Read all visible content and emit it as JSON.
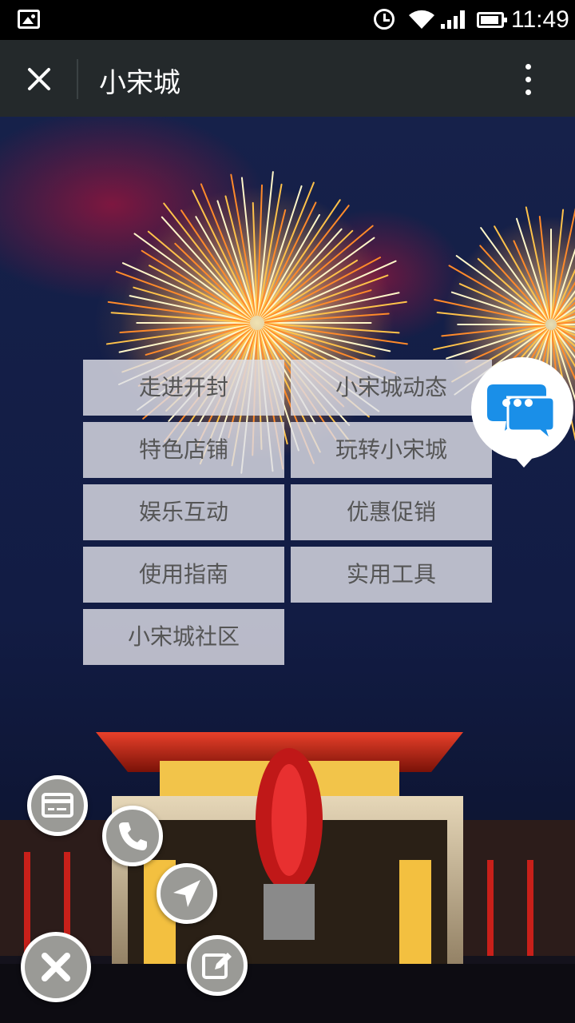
{
  "status_bar": {
    "time": "11:49",
    "icons": [
      "gallery-icon",
      "alarm-icon",
      "wifi-icon",
      "signal-icon",
      "battery-icon"
    ]
  },
  "title_bar": {
    "title": "小宋城",
    "close_icon": "close-icon",
    "more_icon": "more-vertical-icon"
  },
  "menu": {
    "items": [
      {
        "label": "走进开封"
      },
      {
        "label": "小宋城动态"
      },
      {
        "label": "特色店铺"
      },
      {
        "label": "玩转小宋城"
      },
      {
        "label": "娱乐互动"
      },
      {
        "label": "优惠促销"
      },
      {
        "label": "使用指南"
      },
      {
        "label": "实用工具"
      },
      {
        "label": "小宋城社区"
      }
    ]
  },
  "chat": {
    "icon": "chat-bubble-icon",
    "color": "#1a8fe8"
  },
  "floating_buttons": [
    {
      "icon": "card-icon"
    },
    {
      "icon": "phone-icon"
    },
    {
      "icon": "navigation-arrow-icon"
    },
    {
      "icon": "close-icon"
    },
    {
      "icon": "edit-icon"
    }
  ],
  "colors": {
    "title_bar": "#24292b",
    "status_bar": "#000000",
    "fab_bg": "#9a9a96"
  }
}
